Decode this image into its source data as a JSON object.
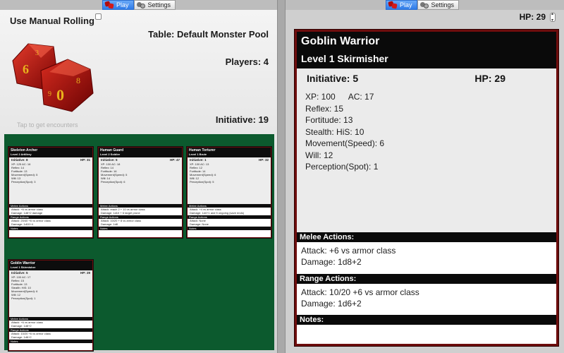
{
  "tabs_left": [
    {
      "label": "Play",
      "active": true
    },
    {
      "label": "Settings",
      "active": false
    }
  ],
  "tabs_right": [
    {
      "label": "Play",
      "active": true
    },
    {
      "label": "Settings",
      "active": false
    }
  ],
  "left": {
    "manual_rolling_label": "Use Manual Rolling",
    "manual_rolling_checked": false,
    "table_text": "Table:  Default Monster Pool",
    "players_text": "Players:  4",
    "initiative_text": "Initiative:  19",
    "tap_hint": "Tap to get encounters"
  },
  "mini_cards": [
    {
      "name": "Skeleton Archer",
      "level": "Level 2 Artillery",
      "initiative": "Initiative: 8",
      "hp": "HP: 31",
      "stats": [
        "XP: 125    AC: 16",
        "Reflex: 14",
        "Fortitude: 13",
        "Movement(Speed): 5",
        "Will: 13",
        "Perception(Spot): 3"
      ],
      "melee": [
        "Attack: +6 vs armor class",
        "Damage: 1d8+2 damage"
      ],
      "range": [
        "Attack: 20/40 +6 vs armor class",
        "Damage: 1d10+4"
      ]
    },
    {
      "name": "Human Guard",
      "level": "Level 2 Soldier",
      "initiative": "Initiative: 5",
      "hp": "HP: 47",
      "stats": [
        "XP: 100    AC: 18",
        "Reflex: 14",
        "Fortitude: 16",
        "Movement(Speed): 5",
        "Will: 14",
        "Perception(Spot): 6"
      ],
      "melee": [
        "Attack: reach 2 + 10 vs armor class",
        "Damage: 1d10 + 6 target prone"
      ],
      "range": [
        "Attack: 10/20 + 8 vs armor class",
        "Damage: 1d8"
      ]
    },
    {
      "name": "Human Torturer",
      "level": "Level 1 Brute",
      "initiative": "Initiative: 1",
      "hp": "HP: 32",
      "stats": [
        "XP: 100    AC: 13",
        "Reflex: 12",
        "Fortitude: 14",
        "Movement(Speed): 6",
        "Will: 12",
        "Perception(Spot): 5"
      ],
      "melee": [
        "Attack: +4 vs armor class",
        "Damage: 1d4+1 and 5 ongoing (save ends)"
      ],
      "range": [
        "Attack: None",
        "Damage: None"
      ]
    },
    {
      "name": "Goblin Warrior",
      "level": "Level 1 Skirmisher",
      "initiative": "Initiative: 5",
      "hp": "HP: 29",
      "stats": [
        "XP: 100    AC: 17",
        "Reflex: 15",
        "Fortitude: 13",
        "Stealth: HiS: 10",
        "Movement(Speed): 6",
        "Will: 12",
        "Perception(Spot): 1"
      ],
      "melee": [
        "Attack: +6 vs armor class",
        "Damage: 1d8+2"
      ],
      "range": [
        "Attack: 10/20 +6 vs armor class",
        "Damage: 1d6+2"
      ]
    }
  ],
  "mini_labels": {
    "melee": "Melee Actions",
    "range": "Range Actions",
    "notes": "Notes"
  },
  "right": {
    "hp_text": "HP:  29",
    "card": {
      "name": "Goblin Warrior",
      "level": "Level 1 Skirmisher",
      "initiative": "Initiative: 5",
      "hp": "HP: 29",
      "xp": "XP: 100",
      "ac": "AC: 17",
      "reflex": "Reflex: 15",
      "fortitude": "Fortitude: 13",
      "stealth": "Stealth: HiS: 10",
      "movement": "Movement(Speed): 6",
      "will": "Will: 12",
      "perception": "Perception(Spot): 1",
      "melee_header": "Melee Actions:",
      "melee_attack": "Attack: +6 vs armor class",
      "melee_damage": "Damage: 1d8+2",
      "range_header": "Range Actions:",
      "range_attack": "Attack: 10/20 +6 vs armor class",
      "range_damage": "Damage: 1d6+2",
      "notes_header": "Notes:"
    }
  }
}
